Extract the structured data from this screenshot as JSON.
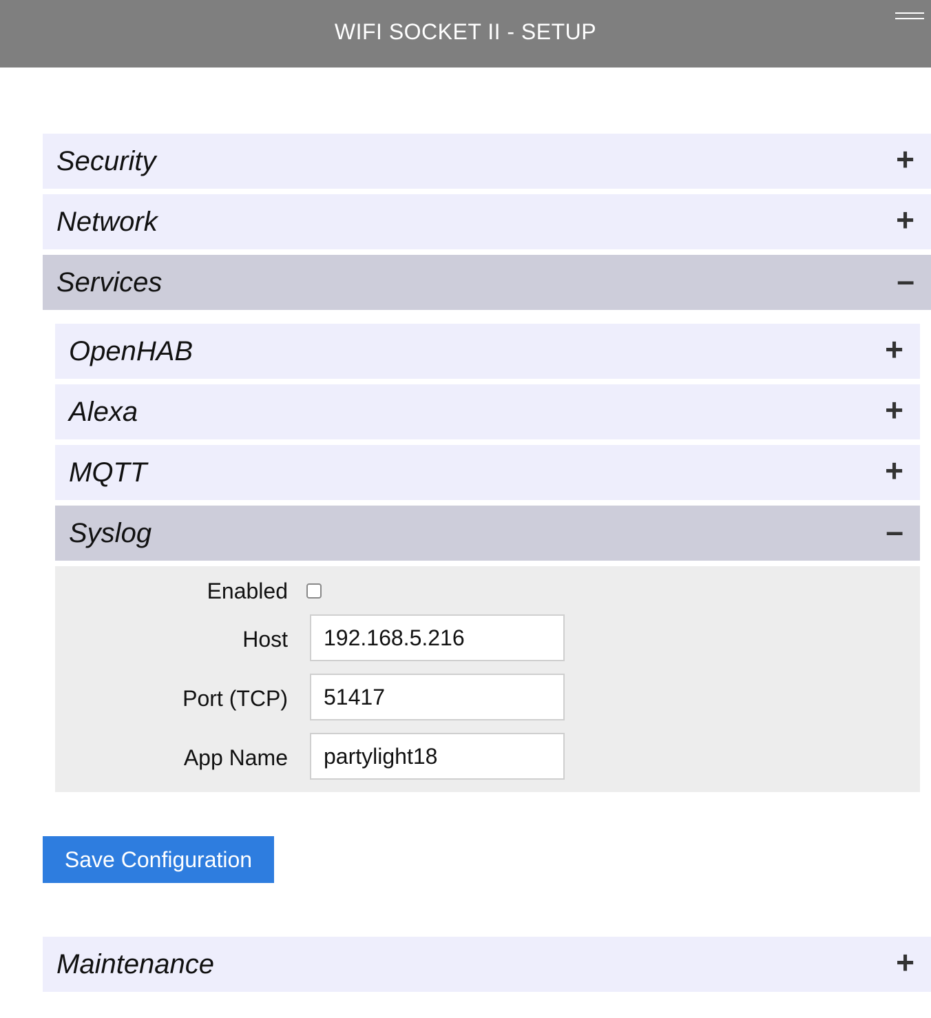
{
  "header": {
    "title": "WIFI SOCKET II - SETUP",
    "menu_icon": "hamburger-icon"
  },
  "sections": {
    "security": {
      "label": "Security",
      "state": "collapsed",
      "sign": "+"
    },
    "network": {
      "label": "Network",
      "state": "collapsed",
      "sign": "+"
    },
    "services": {
      "label": "Services",
      "state": "expanded",
      "sign": "–",
      "subsections": {
        "openhab": {
          "label": "OpenHAB",
          "state": "collapsed",
          "sign": "+"
        },
        "alexa": {
          "label": "Alexa",
          "state": "collapsed",
          "sign": "+"
        },
        "mqtt": {
          "label": "MQTT",
          "state": "collapsed",
          "sign": "+"
        },
        "syslog": {
          "label": "Syslog",
          "state": "expanded",
          "sign": "–",
          "fields": {
            "enabled_label": "Enabled",
            "enabled_checked": false,
            "host_label": "Host",
            "host_value": "192.168.5.216",
            "port_label": "Port (TCP)",
            "port_value": "51417",
            "appname_label": "App Name",
            "appname_value": "partylight18"
          }
        }
      }
    },
    "maintenance": {
      "label": "Maintenance",
      "state": "collapsed",
      "sign": "+"
    }
  },
  "actions": {
    "save_label": "Save Configuration"
  },
  "colors": {
    "header_bg": "#7f7f7f",
    "collapsed_bg": "#eeeefc",
    "expanded_bg": "#cdcdda",
    "panel_bg": "#ededed",
    "button_bg": "#2e7ddf"
  }
}
